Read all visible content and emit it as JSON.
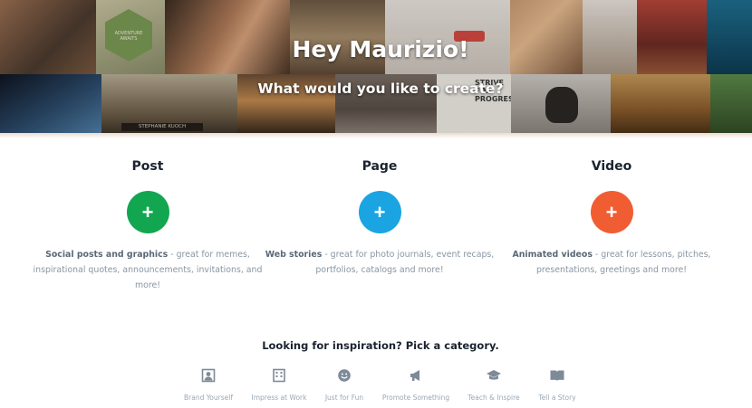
{
  "hero": {
    "greeting": "Hey Maurizio!",
    "prompt": "What would you like to create?",
    "tile_captions": {
      "adventure_badge": "ADVENTURE AWAITS",
      "street_sign": "STEPHANIE KUOCH",
      "poster": "STRIVE FOR PROGRESS"
    }
  },
  "options": [
    {
      "title": "Post",
      "button_symbol": "+",
      "color": "#12a650",
      "desc_strong": "Social posts and graphics",
      "desc_rest": " - great for memes, inspirational quotes, announcements, invitations, and more!"
    },
    {
      "title": "Page",
      "button_symbol": "+",
      "color": "#1aa4e2",
      "desc_strong": "Web stories",
      "desc_rest": " - great for photo journals, event recaps, portfolios, catalogs and more!"
    },
    {
      "title": "Video",
      "button_symbol": "+",
      "color": "#f05d33",
      "desc_strong": "Animated videos",
      "desc_rest": " - great for lessons, pitches, presentations, greetings and more!"
    }
  ],
  "inspiration": {
    "heading": "Looking for inspiration? Pick a category.",
    "categories": [
      {
        "label": "Brand Yourself",
        "icon": "person-portrait-icon"
      },
      {
        "label": "Impress at Work",
        "icon": "building-icon"
      },
      {
        "label": "Just for Fun",
        "icon": "smiley-face-icon"
      },
      {
        "label": "Promote Something",
        "icon": "megaphone-icon"
      },
      {
        "label": "Teach & Inspire",
        "icon": "graduation-cap-icon"
      },
      {
        "label": "Tell a Story",
        "icon": "open-book-icon"
      }
    ]
  }
}
